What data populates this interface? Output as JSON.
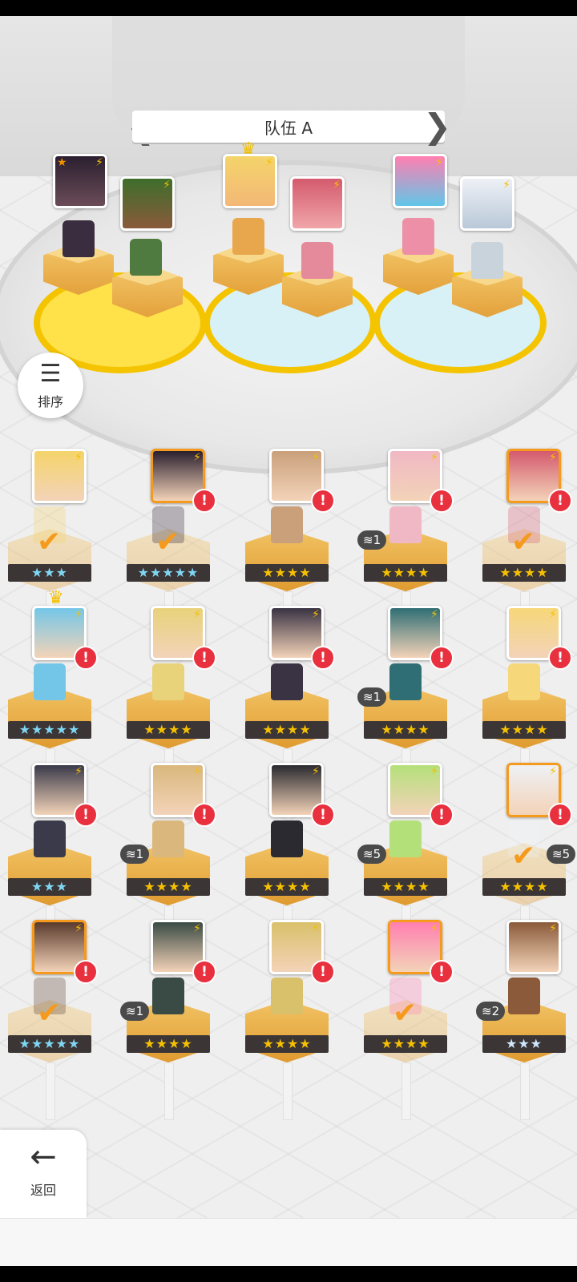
{
  "team": {
    "title": "队伍 A",
    "prev_icon": "chevron-left-icon",
    "next_icon": "chevron-right-icon"
  },
  "sort_button": {
    "label": "排序",
    "icon": "sort-icon"
  },
  "back_button": {
    "label": "返回",
    "icon": "arrow-left-icon"
  },
  "roster": [
    {
      "row": 1,
      "stars": "★★★",
      "badge": ""
    },
    {
      "row": 1,
      "stars": "★★★★★",
      "badge": ""
    },
    {
      "row": 1,
      "stars": "★★★★",
      "badge": ""
    },
    {
      "row": 1,
      "stars": "★★★★",
      "badge": "1"
    },
    {
      "row": 1,
      "stars": "★★★★",
      "badge": ""
    },
    {
      "row": 2,
      "stars": "★★★★★",
      "badge": ""
    },
    {
      "row": 2,
      "stars": "★★★★",
      "badge": ""
    },
    {
      "row": 2,
      "stars": "★★★★",
      "badge": ""
    },
    {
      "row": 2,
      "stars": "★★★★",
      "badge": "1"
    },
    {
      "row": 2,
      "stars": "★★★★",
      "badge": ""
    },
    {
      "row": 3,
      "stars": "★★★",
      "badge": ""
    },
    {
      "row": 3,
      "stars": "★★★★",
      "badge": "1"
    },
    {
      "row": 3,
      "stars": "★★★★",
      "badge": ""
    },
    {
      "row": 3,
      "stars": "★★★★",
      "badge": "5"
    },
    {
      "row": 3,
      "stars": "★★★★",
      "badge": ""
    },
    {
      "row": 4,
      "stars": "★★★★★",
      "badge": ""
    },
    {
      "row": 4,
      "stars": "★★★★",
      "badge": "1"
    },
    {
      "row": 4,
      "stars": "★★★★",
      "badge": ""
    },
    {
      "row": 4,
      "stars": "★★★★",
      "badge": ""
    },
    {
      "row": 4,
      "stars": "★★★",
      "badge": "2"
    }
  ],
  "edge_badge": "5",
  "colors": {
    "accent": "#f59a1c",
    "alert": "#e8303e",
    "gold": "#f4c000"
  }
}
